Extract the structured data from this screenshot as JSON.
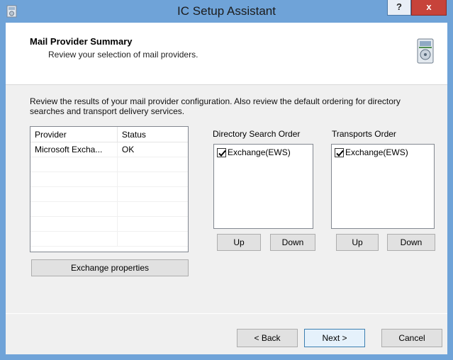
{
  "window": {
    "title": "IC Setup Assistant",
    "help_label": "?",
    "close_label": "x"
  },
  "header": {
    "title": "Mail Provider Summary",
    "subtitle": "Review your selection of mail providers."
  },
  "description": "Review the results of your mail provider configuration. Also review the default ordering for directory searches and transport delivery services.",
  "providers": {
    "columns": [
      "Provider",
      "Status"
    ],
    "rows": [
      {
        "provider": "Microsoft Excha...",
        "status": "OK"
      }
    ],
    "properties_button": "Exchange properties"
  },
  "directory_search": {
    "label": "Directory Search Order",
    "items": [
      {
        "label": "Exchange(EWS)",
        "checked": true
      }
    ],
    "up_label": "Up",
    "down_label": "Down"
  },
  "transports": {
    "label": "Transports Order",
    "items": [
      {
        "label": "Exchange(EWS)",
        "checked": true
      }
    ],
    "up_label": "Up",
    "down_label": "Down"
  },
  "footer": {
    "back_label": "< Back",
    "next_label": "Next >",
    "cancel_label": "Cancel"
  },
  "icons": {
    "app": "setup-app-icon",
    "header": "install-disk-icon",
    "check": "checkmark-icon"
  },
  "colors": {
    "titlebar": "#6fa3d8",
    "close": "#c7433a",
    "default_button_border": "#3c7fb1"
  }
}
